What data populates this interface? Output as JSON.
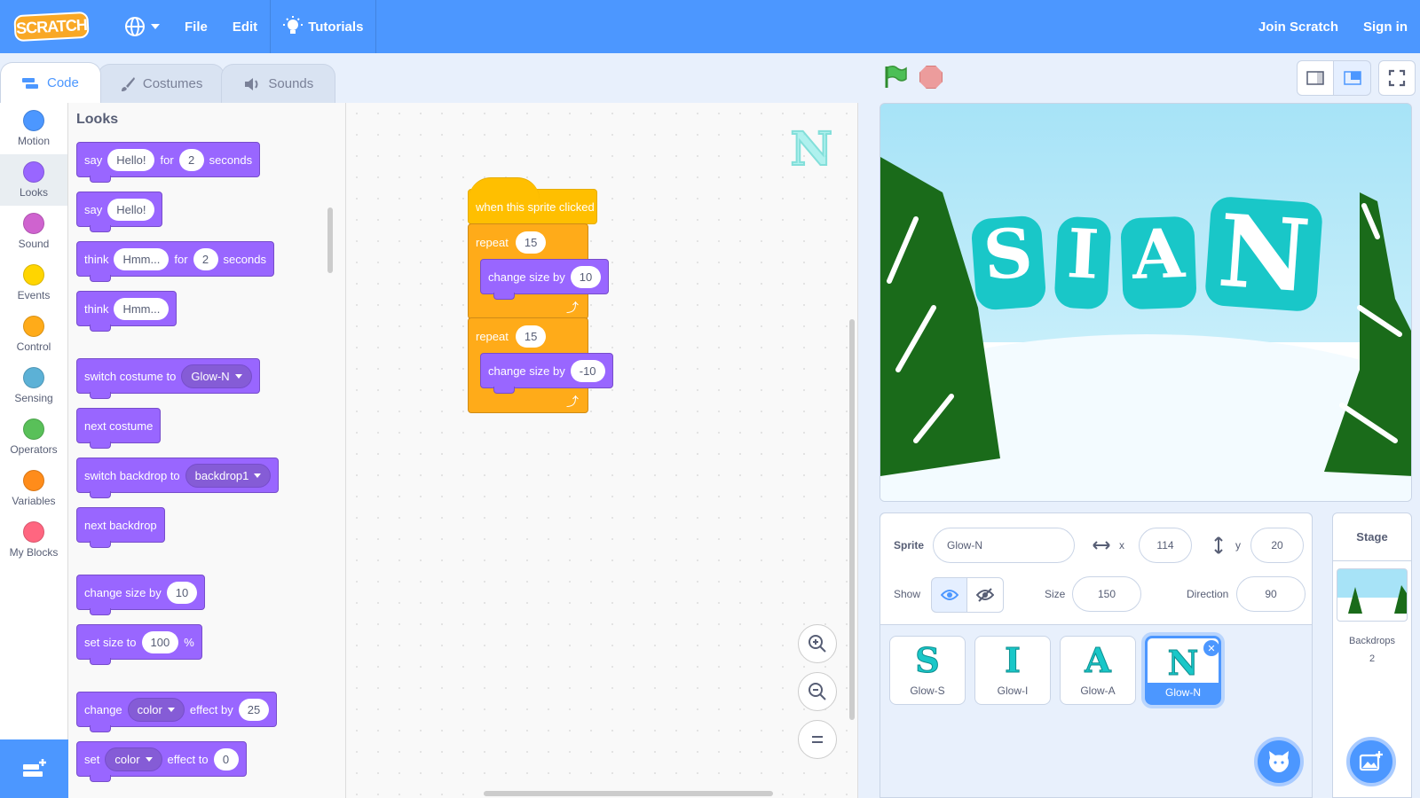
{
  "menu": {
    "logo": "SCRATCH",
    "file": "File",
    "edit": "Edit",
    "tutorials": "Tutorials",
    "join": "Join Scratch",
    "signin": "Sign in"
  },
  "tabs": [
    "Code",
    "Costumes",
    "Sounds"
  ],
  "categories": [
    {
      "label": "Motion",
      "color": "#4c97ff"
    },
    {
      "label": "Looks",
      "color": "#9966ff"
    },
    {
      "label": "Sound",
      "color": "#cf63cf"
    },
    {
      "label": "Events",
      "color": "#ffd500"
    },
    {
      "label": "Control",
      "color": "#ffab19"
    },
    {
      "label": "Sensing",
      "color": "#5cb1d6"
    },
    {
      "label": "Operators",
      "color": "#59c059"
    },
    {
      "label": "Variables",
      "color": "#ff8c1a"
    },
    {
      "label": "My Blocks",
      "color": "#ff6680"
    }
  ],
  "palette": {
    "title": "Looks",
    "say_for": {
      "say": "say",
      "msg": "Hello!",
      "for": "for",
      "secs": "2",
      "unit": "seconds"
    },
    "say": {
      "say": "say",
      "msg": "Hello!"
    },
    "think_for": {
      "think": "think",
      "msg": "Hmm...",
      "for": "for",
      "secs": "2",
      "unit": "seconds"
    },
    "think": {
      "think": "think",
      "msg": "Hmm..."
    },
    "switch_costume": {
      "label": "switch costume to",
      "value": "Glow-N"
    },
    "next_costume": "next costume",
    "switch_backdrop": {
      "label": "switch backdrop to",
      "value": "backdrop1"
    },
    "next_backdrop": "next backdrop",
    "change_size": {
      "label": "change size by",
      "value": "10"
    },
    "set_size": {
      "label": "set size to",
      "value": "100",
      "unit": "%"
    },
    "change_effect": {
      "change": "change",
      "effect": "color",
      "by": "effect by",
      "value": "25"
    },
    "set_effect": {
      "set": "set",
      "effect": "color",
      "to": "effect to",
      "value": "0"
    }
  },
  "script": {
    "hat": "when this sprite clicked",
    "repeat1": {
      "label": "repeat",
      "count": "15"
    },
    "change1": {
      "label": "change size by",
      "value": "10"
    },
    "repeat2": {
      "label": "repeat",
      "count": "15"
    },
    "change2": {
      "label": "change size by",
      "value": "-10"
    },
    "corner_glyph": "N"
  },
  "stage_letters": [
    "S",
    "I",
    "A",
    "N"
  ],
  "sprite_info": {
    "sprite_label": "Sprite",
    "sprite_name": "Glow-N",
    "x_label": "x",
    "x": "114",
    "y_label": "y",
    "y": "20",
    "show_label": "Show",
    "size_label": "Size",
    "size": "150",
    "direction_label": "Direction",
    "direction": "90"
  },
  "sprites": [
    {
      "name": "Glow-S",
      "glyph": "S"
    },
    {
      "name": "Glow-I",
      "glyph": "I"
    },
    {
      "name": "Glow-A",
      "glyph": "A"
    },
    {
      "name": "Glow-N",
      "glyph": "N"
    }
  ],
  "stage_pane": {
    "title": "Stage",
    "backdrops_label": "Backdrops",
    "backdrops_count": "2"
  }
}
